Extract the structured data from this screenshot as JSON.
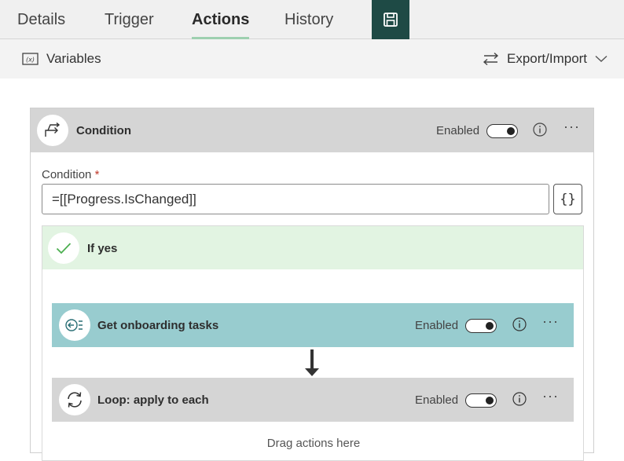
{
  "tabs": {
    "details": "Details",
    "trigger": "Trigger",
    "actions": "Actions",
    "history": "History",
    "save_icon": "save-icon"
  },
  "toolbar": {
    "variables_label": "Variables",
    "variables_icon": "variables-icon",
    "export_import_label": "Export/Import",
    "export_import_icon": "swap-arrows-icon"
  },
  "condition": {
    "title": "Condition",
    "enabled_label": "Enabled",
    "enabled": true,
    "field_label": "Condition",
    "required_mark": "*",
    "value": "=[[Progress.IsChanged]]",
    "expression_button": "{}",
    "if_yes": {
      "title": "If yes",
      "actions": [
        {
          "title": "Get onboarding tasks",
          "enabled_label": "Enabled",
          "enabled": true,
          "icon": "list-arrow-icon",
          "color": "#98cccf"
        },
        {
          "title": "Loop: apply to each",
          "enabled_label": "Enabled",
          "enabled": true,
          "icon": "loop-icon",
          "color": "#d5d5d5"
        }
      ],
      "drag_hint": "Drag actions here"
    }
  },
  "colors": {
    "accent_dark": "#1e4a45",
    "tab_underline": "#9ed0b0",
    "if_yes_bg": "#e2f4e2",
    "teal_action": "#98cccf",
    "grey_header": "#d5d5d5"
  }
}
